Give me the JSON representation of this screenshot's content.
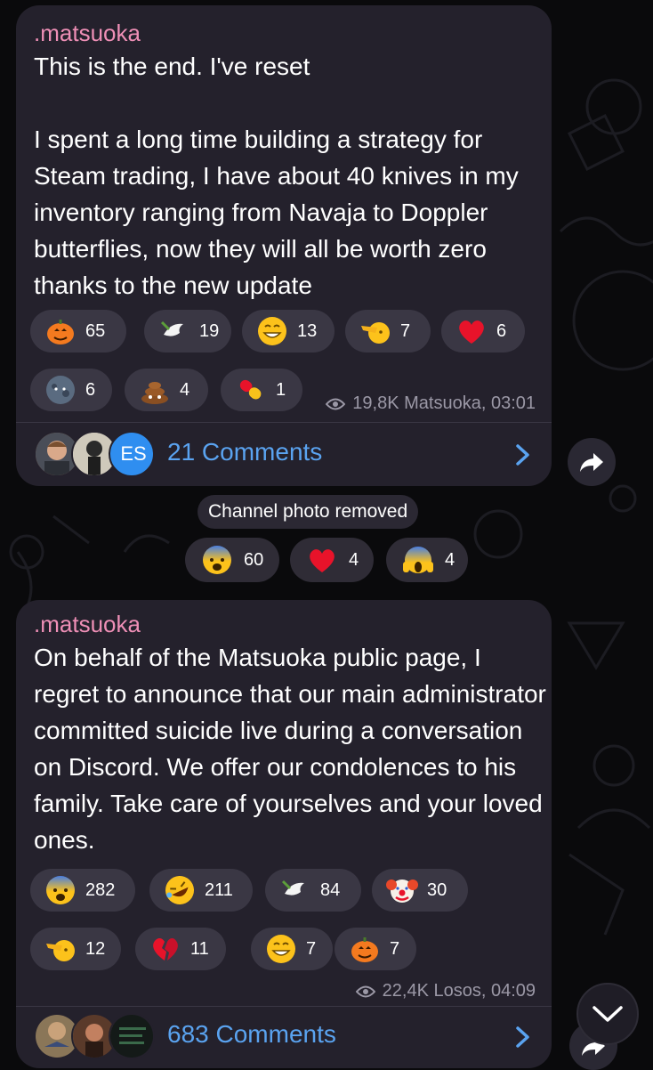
{
  "messages": [
    {
      "author": ".matsuoka",
      "paragraphs": [
        "This is the end. I've reset",
        "I spent a long time building a strategy for Steam trading, I have about 40 knives in my inventory ranging from Navaja to Doppler butterflies, now they will all be worth zero thanks to the new update"
      ],
      "reactions": [
        {
          "icon": "pumpkin-emoji",
          "count": "65"
        },
        {
          "icon": "dove-emoji",
          "count": "19"
        },
        {
          "icon": "grin-emoji",
          "count": "13"
        },
        {
          "icon": "salute-emoji",
          "count": "7"
        },
        {
          "icon": "heart-emoji",
          "count": "6"
        },
        {
          "icon": "new-moon-face-emoji",
          "count": "6"
        },
        {
          "icon": "poop-emoji",
          "count": "4"
        },
        {
          "icon": "pill-emoji",
          "count": "1"
        }
      ],
      "meta": "19,8K Matsuoka, 03:01",
      "avatar_badge": "ES",
      "comments": "21 Comments"
    },
    {
      "author": ".matsuoka",
      "paragraphs": [
        "On behalf of the Matsuoka public page, I regret to announce that our main administrator committed suicide live during a conversation on Discord. We offer our condolences to his family. Take care of yourselves and your loved ones."
      ],
      "reactions": [
        {
          "icon": "fearful-emoji",
          "count": "282"
        },
        {
          "icon": "rofl-emoji",
          "count": "211"
        },
        {
          "icon": "dove-emoji",
          "count": "84"
        },
        {
          "icon": "clown-emoji",
          "count": "30"
        },
        {
          "icon": "salute-emoji",
          "count": "12"
        },
        {
          "icon": "broken-heart-emoji",
          "count": "11"
        },
        {
          "icon": "grin-emoji",
          "count": "7"
        },
        {
          "icon": "pumpkin-emoji",
          "count": "7"
        }
      ],
      "meta": "22,4K Losos, 04:09",
      "comments": "683 Comments"
    }
  ],
  "service": {
    "text": "Channel photo removed",
    "reactions": [
      {
        "icon": "fearful-emoji",
        "count": "60"
      },
      {
        "icon": "heart-emoji",
        "count": "4"
      },
      {
        "icon": "scream-emoji",
        "count": "4"
      }
    ]
  },
  "colors": {
    "bubble": "#24212c",
    "reaction_pill": "#3a3744",
    "author": "#ee8fb6",
    "link": "#5aa3f0",
    "meta": "#9b98a6"
  }
}
